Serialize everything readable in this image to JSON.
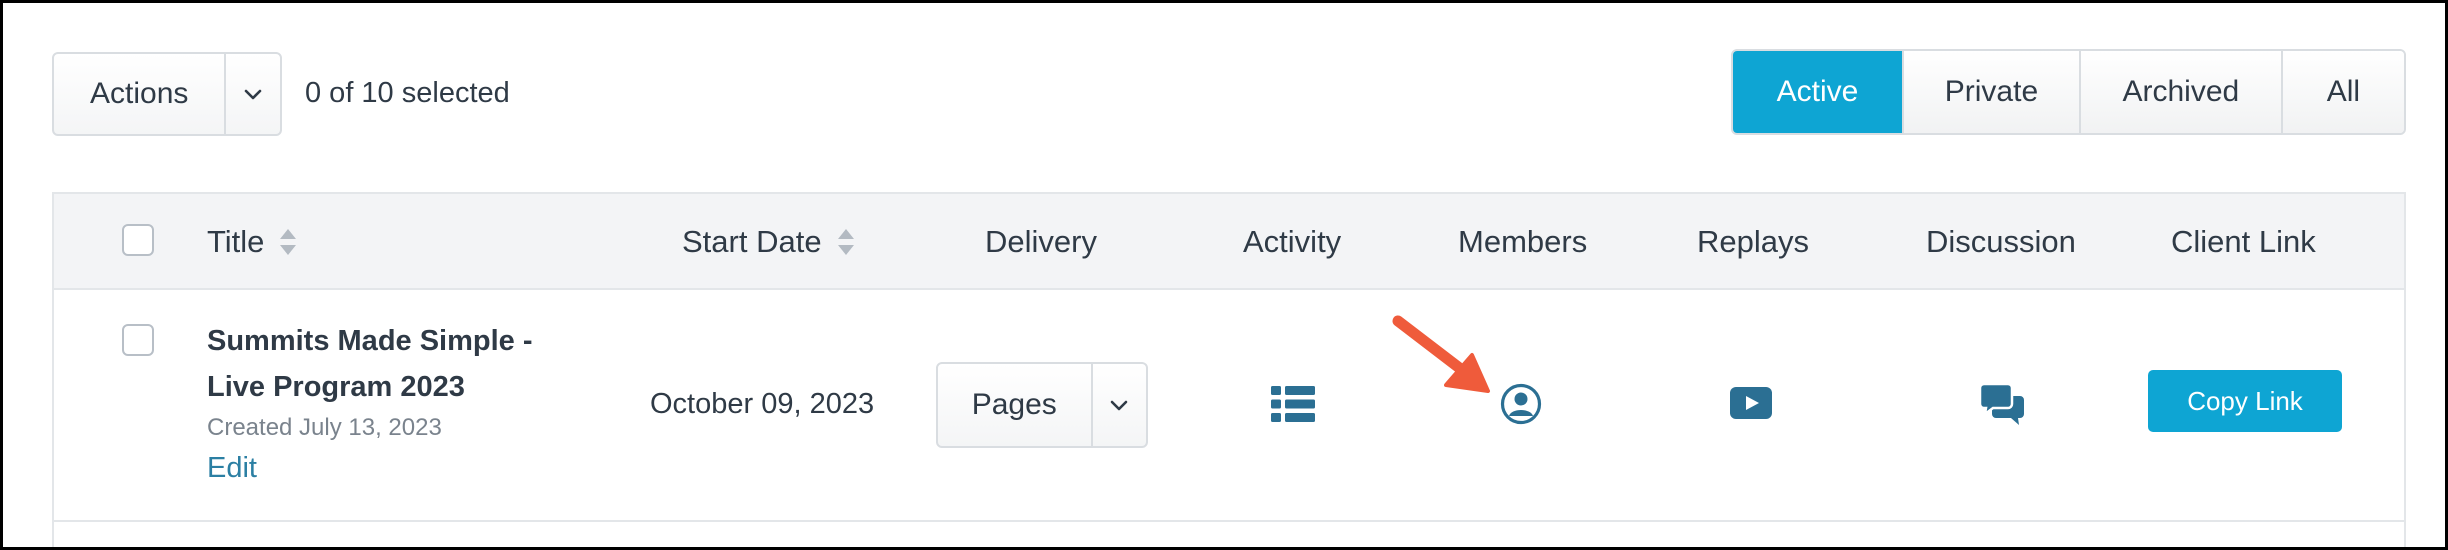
{
  "toolbar": {
    "actions_label": "Actions",
    "selected_text": "0 of 10 selected"
  },
  "filters": {
    "tabs": [
      "Active",
      "Private",
      "Archived",
      "All"
    ],
    "active": "Active"
  },
  "table": {
    "headers": {
      "title": "Title",
      "start_date": "Start Date",
      "delivery": "Delivery",
      "activity": "Activity",
      "members": "Members",
      "replays": "Replays",
      "discussion": "Discussion",
      "client_link": "Client Link"
    },
    "rows": [
      {
        "title": "Summits Made Simple - Live Program 2023",
        "created": "Created July 13, 2023",
        "edit_label": "Edit",
        "start_date": "October 09, 2023",
        "delivery_label": "Pages",
        "copy_link_label": "Copy Link"
      }
    ]
  },
  "icons": {
    "activity": "list-icon",
    "members": "user-circle-icon",
    "replays": "video-play-icon",
    "discussion": "chat-bubbles-icon",
    "sort": "sort-icon",
    "caret": "chevron-down-icon",
    "annotation": "red-arrow-icon"
  },
  "colors": {
    "accent": "#0ea5d3",
    "icon": "#2b6f93",
    "link": "#2b7fa3",
    "arrow": "#ef5b3b"
  }
}
